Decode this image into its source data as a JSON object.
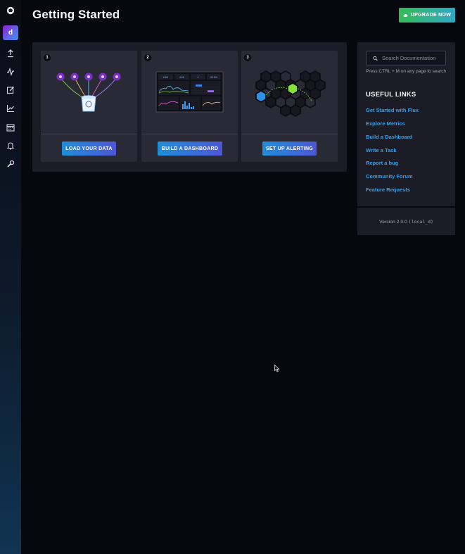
{
  "header": {
    "title": "Getting Started",
    "upgrade_label": "UPGRADE NOW"
  },
  "sidebar": {
    "avatar_letter": "d",
    "items": [
      {
        "icon": "logo-icon"
      },
      {
        "icon": "upload-icon"
      },
      {
        "icon": "data-explorer-icon"
      },
      {
        "icon": "edit-icon"
      },
      {
        "icon": "chart-icon"
      },
      {
        "icon": "calendar-icon"
      },
      {
        "icon": "bell-icon"
      },
      {
        "icon": "wrench-icon"
      }
    ]
  },
  "steps": [
    {
      "number": "1",
      "button": "LOAD YOUR DATA"
    },
    {
      "number": "2",
      "button": "BUILD A DASHBOARD"
    },
    {
      "number": "3",
      "button": "SET UP ALERTING"
    }
  ],
  "dashboard_art": {
    "cells": [
      "6.8K",
      "4.6K",
      "4",
      "99.5%"
    ]
  },
  "docs": {
    "search_placeholder": "Search Documentation",
    "hint": "Press CTRL + M on any page to search",
    "links_title": "USEFUL LINKS",
    "links": [
      "Get Started with Flux",
      "Explore Metrics",
      "Build a Dashboard",
      "Write a Task",
      "Report a bug",
      "Community Forum",
      "Feature Requests"
    ],
    "version_label": "Version 2.0.0",
    "version_tag": "(local_d)"
  },
  "colors": {
    "accent_blue": "#37a0e6",
    "upgrade_green": "#34bb55",
    "button_gradient_start": "#1e8fd8",
    "button_gradient_end": "#4d56d6"
  }
}
